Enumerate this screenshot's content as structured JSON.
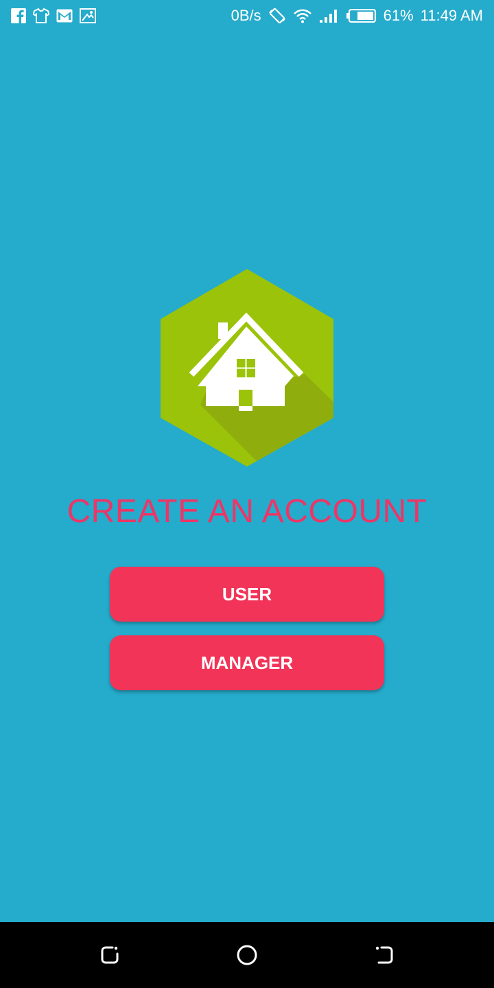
{
  "status_bar": {
    "network_speed": "0B/s",
    "battery_percent": "61%",
    "time": "11:49 AM",
    "notification_icons": [
      "facebook-icon",
      "tshirt-icon",
      "gmail-icon",
      "screencast-icon"
    ],
    "system_icons": [
      "rotate-icon",
      "wifi-icon",
      "signal-icon",
      "battery-icon"
    ]
  },
  "logo": {
    "icon": "house-hexagon-logo",
    "hexagon_color": "#9BC30A",
    "shadow_color": "#8FAE0D",
    "house_color": "#FFFFFF"
  },
  "main": {
    "title": "CREATE AN ACCOUNT",
    "user_button_label": "USER",
    "manager_button_label": "MANAGER"
  },
  "colors": {
    "background": "#25ABCB",
    "title": "#EE3566",
    "button": "#F23458",
    "nav_bar": "#000000"
  },
  "nav_bar": {
    "buttons": [
      "recent-apps-icon",
      "home-icon",
      "back-icon"
    ]
  }
}
